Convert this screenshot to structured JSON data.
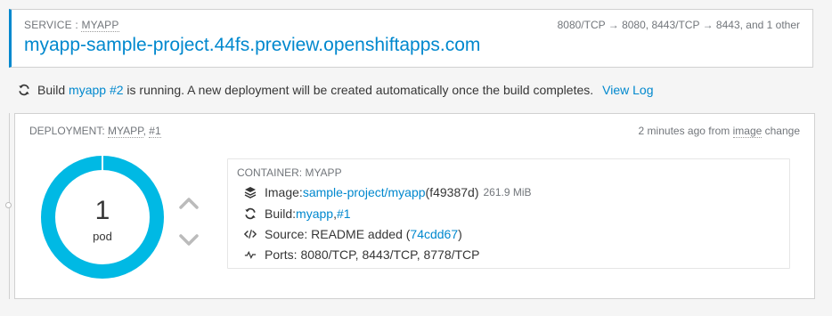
{
  "service": {
    "label_prefix": "SERVICE : ",
    "name": "MYAPP",
    "ports": "8080/TCP → 8080, 8443/TCP → 8443, and 1 other",
    "url": "myapp-sample-project.44fs.preview.openshiftapps.com"
  },
  "build_notice": {
    "prefix": "Build",
    "build_link": "myapp #2",
    "message": "is running. A new deployment will be created automatically once the build completes.",
    "view_log": "View Log"
  },
  "deployment": {
    "label_prefix": "DEPLOYMENT: ",
    "name": "MYAPP",
    "sep": ", ",
    "revision": "#1",
    "time_prefix": "2 minutes ago from ",
    "time_trigger": "image",
    "time_suffix": " change",
    "pods": {
      "count": "1",
      "unit": "pod",
      "ring_color": "#00b9e4"
    }
  },
  "container": {
    "label": "CONTAINER: MYAPP",
    "image": {
      "label": "Image: ",
      "link": "sample-project/myapp",
      "hash": " (f49387d)",
      "size": "261.9 MiB"
    },
    "build": {
      "label": "Build: ",
      "link1": "myapp",
      "sep": ", ",
      "link2": "#1"
    },
    "source": {
      "label": "Source: README added (",
      "link": "74cdd67",
      "suffix": ")"
    },
    "ports": {
      "text": "Ports: 8080/TCP, 8443/TCP, 8778/TCP"
    }
  },
  "icons": {
    "build_status": "refresh-icon",
    "image": "layers-icon",
    "build": "refresh-icon",
    "source": "code-icon",
    "ports": "pulse-icon",
    "scale_up": "chevron-up-icon",
    "scale_down": "chevron-down-icon"
  }
}
